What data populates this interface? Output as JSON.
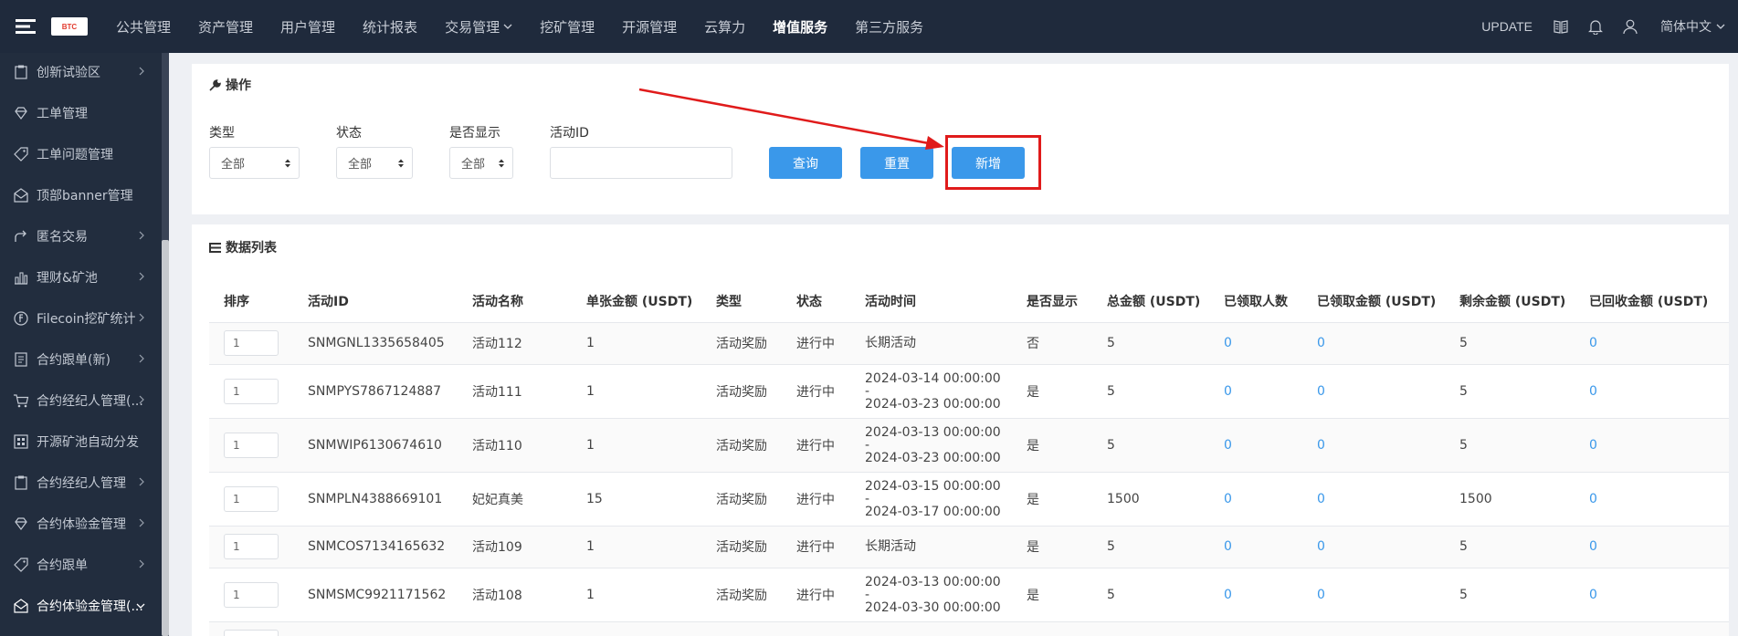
{
  "brand": {
    "logo_text": "BTC"
  },
  "topnav": {
    "items": [
      {
        "label": "公共管理"
      },
      {
        "label": "资产管理"
      },
      {
        "label": "用户管理"
      },
      {
        "label": "统计报表"
      },
      {
        "label": "交易管理"
      },
      {
        "label": "挖矿管理"
      },
      {
        "label": "开源管理"
      },
      {
        "label": "云算力"
      },
      {
        "label": "增值服务"
      },
      {
        "label": "第三方服务"
      }
    ],
    "active_index": 8,
    "update_label": "UPDATE",
    "lang_label": "简体中文"
  },
  "sidebar": {
    "items": [
      {
        "label": "创新试验区",
        "icon": "clipboard-icon"
      },
      {
        "label": "工单管理",
        "icon": "diamond-icon"
      },
      {
        "label": "工单问题管理",
        "icon": "tag-icon"
      },
      {
        "label": "顶部banner管理",
        "icon": "mail-icon"
      },
      {
        "label": "匿名交易",
        "icon": "share-icon"
      },
      {
        "label": "理财&矿池",
        "icon": "bar-chart-icon"
      },
      {
        "label": "Filecoin挖矿统计",
        "icon": "coin-icon"
      },
      {
        "label": "合约跟单(新)",
        "icon": "book-icon"
      },
      {
        "label": "合约经纪人管理(...",
        "icon": "cart-icon"
      },
      {
        "label": "开源矿池自动分发",
        "icon": "grid-icon"
      },
      {
        "label": "合约经纪人管理",
        "icon": "clipboard-icon"
      },
      {
        "label": "合约体验金管理",
        "icon": "diamond-icon"
      },
      {
        "label": "合约跟单",
        "icon": "tag-icon"
      },
      {
        "label": "合约体验金管理(...",
        "icon": "mail-icon"
      }
    ]
  },
  "operation": {
    "title": "操作",
    "filters": {
      "type_label": "类型",
      "type_value": "全部",
      "status_label": "状态",
      "status_value": "全部",
      "display_label": "是否显示",
      "display_value": "全部",
      "activity_id_label": "活动ID",
      "activity_id_value": ""
    },
    "buttons": {
      "query": "查询",
      "reset": "重置",
      "add": "新增"
    }
  },
  "list": {
    "title": "数据列表",
    "columns": [
      "排序",
      "活动ID",
      "活动名称",
      "单张金额 (USDT)",
      "类型",
      "状态",
      "活动时间",
      "是否显示",
      "总金额 (USDT)",
      "已领取人数",
      "已领取金额 (USDT)",
      "剩余金额 (USDT)",
      "已回收金额 (USDT)"
    ],
    "rows": [
      {
        "sort": "1",
        "id": "SNMGNL1335658405",
        "name": "活动112",
        "unit": "1",
        "type": "活动奖励",
        "status": "进行中",
        "time_start": "长期活动",
        "time_sep": "",
        "time_end": "",
        "display": "否",
        "total": "5",
        "claimed_people": "0",
        "claimed_amount": "0",
        "remaining": "5",
        "recovered": "0"
      },
      {
        "sort": "1",
        "id": "SNMPYS7867124887",
        "name": "活动111",
        "unit": "1",
        "type": "活动奖励",
        "status": "进行中",
        "time_start": "2024-03-14 00:00:00",
        "time_sep": "-",
        "time_end": "2024-03-23 00:00:00",
        "display": "是",
        "total": "5",
        "claimed_people": "0",
        "claimed_amount": "0",
        "remaining": "5",
        "recovered": "0"
      },
      {
        "sort": "1",
        "id": "SNMWIP6130674610",
        "name": "活动110",
        "unit": "1",
        "type": "活动奖励",
        "status": "进行中",
        "time_start": "2024-03-13 00:00:00",
        "time_sep": "-",
        "time_end": "2024-03-23 00:00:00",
        "display": "是",
        "total": "5",
        "claimed_people": "0",
        "claimed_amount": "0",
        "remaining": "5",
        "recovered": "0"
      },
      {
        "sort": "1",
        "id": "SNMPLN4388669101",
        "name": "妃妃真美",
        "unit": "15",
        "type": "活动奖励",
        "status": "进行中",
        "time_start": "2024-03-15 00:00:00",
        "time_sep": "-",
        "time_end": "2024-03-17 00:00:00",
        "display": "是",
        "total": "1500",
        "claimed_people": "0",
        "claimed_amount": "0",
        "remaining": "1500",
        "recovered": "0"
      },
      {
        "sort": "1",
        "id": "SNMCOS7134165632",
        "name": "活动109",
        "unit": "1",
        "type": "活动奖励",
        "status": "进行中",
        "time_start": "长期活动",
        "time_sep": "",
        "time_end": "",
        "display": "是",
        "total": "5",
        "claimed_people": "0",
        "claimed_amount": "0",
        "remaining": "5",
        "recovered": "0"
      },
      {
        "sort": "1",
        "id": "SNMSMC9921171562",
        "name": "活动108",
        "unit": "1",
        "type": "活动奖励",
        "status": "进行中",
        "time_start": "2024-03-13 00:00:00",
        "time_sep": "-",
        "time_end": "2024-03-30 00:00:00",
        "display": "是",
        "total": "5",
        "claimed_people": "0",
        "claimed_amount": "0",
        "remaining": "5",
        "recovered": "0"
      },
      {
        "sort": "",
        "id": "",
        "name": "",
        "unit": "",
        "type": "",
        "status": "",
        "time_start": "",
        "time_sep": "",
        "time_end": "",
        "display": "",
        "total": "",
        "claimed_people": "",
        "claimed_amount": "",
        "remaining": "",
        "recovered": ""
      }
    ]
  },
  "colors": {
    "topbar": "#1f2a3c",
    "sidebar": "#222d3e",
    "accent": "#3a98ea",
    "highlight": "#e01b1b"
  }
}
